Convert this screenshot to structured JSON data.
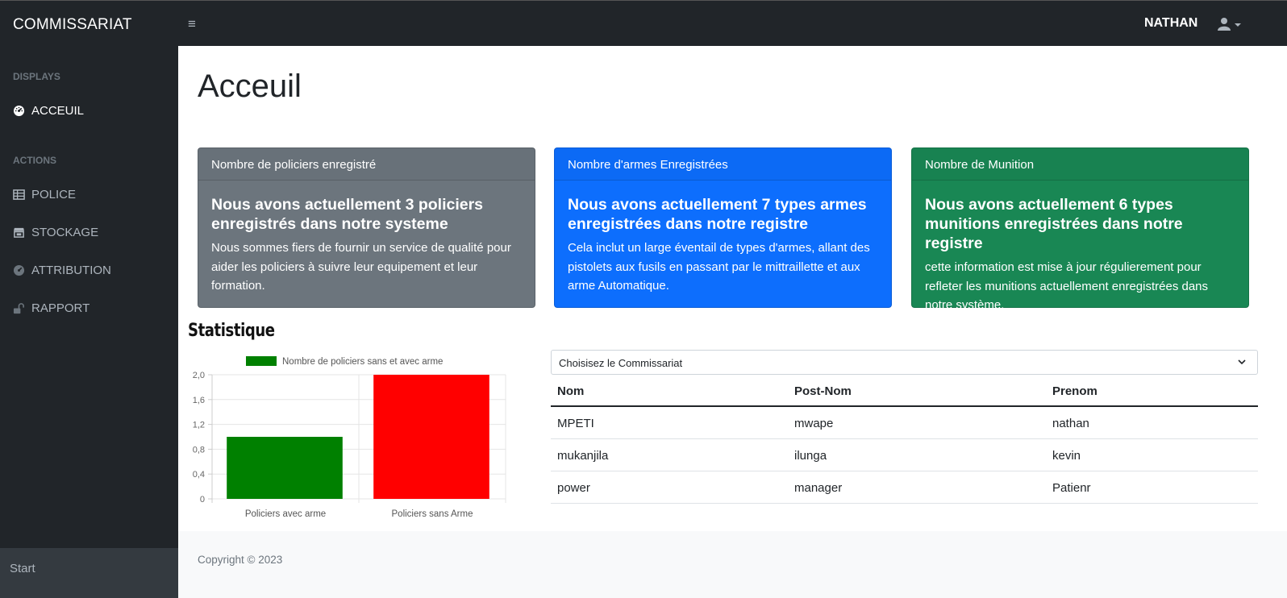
{
  "topbar": {
    "brand": "COMMISSARIAT",
    "toggle_icon": "≡",
    "username": "NATHAN"
  },
  "sidebar": {
    "sections": [
      {
        "label": "DISPLAYS"
      },
      {
        "label": "ACTIONS"
      }
    ],
    "items": [
      {
        "label": "ACCEUIL",
        "icon": "dashboard-icon"
      },
      {
        "label": "POLICE",
        "icon": "table-icon"
      },
      {
        "label": "STOCKAGE",
        "icon": "store-icon"
      },
      {
        "label": "ATTRIBUTION",
        "icon": "dashboard-icon"
      },
      {
        "label": "RAPPORT",
        "icon": "lock-open-icon"
      }
    ],
    "footer": "Start"
  },
  "page": {
    "title": "Acceuil"
  },
  "cards": [
    {
      "header": "Nombre de policiers enregistré",
      "title": "Nous avons actuellement 3 policiers enregistrés dans notre systeme",
      "text": "Nous sommes fiers de fournir un service de qualité pour aider les policiers à suivre leur equipement et leur formation.",
      "color": "#6c757d"
    },
    {
      "header": "Nombre d'armes Enregistrées",
      "title": "Nous avons actuellement 7 types armes enregistrées dans notre registre",
      "text": "Cela inclut un large éventail de types d'armes, allant des pistolets aux fusils en passant par le mittraillette et aux arme Automatique.",
      "color": "#0d6efd"
    },
    {
      "header": "Nombre de Munition",
      "title": "Nous avons actuellement 6 types munitions enregistrées dans notre registre",
      "text": "cette information est mise à jour régulierement pour refleter les munitions actuellement enregistrées dans notre système.",
      "color": "#198754"
    }
  ],
  "statistics": {
    "title": "Statistique"
  },
  "chart_data": {
    "type": "bar",
    "categories": [
      "Policiers avec arme",
      "Policiers sans Arme"
    ],
    "series": [
      {
        "name": "Nombre de policiers sans et avec arme",
        "values": [
          1,
          2
        ],
        "colors": [
          "#008000",
          "#ff0000"
        ]
      }
    ],
    "ylim": [
      0,
      2
    ],
    "yticks": [
      "2,0",
      "1,6",
      "1,2",
      "0,8",
      "0,4",
      "0"
    ],
    "legend": "top",
    "grid": true
  },
  "select": {
    "value": "Choisisez le Commissariat"
  },
  "table": {
    "headers": [
      "Nom",
      "Post-Nom",
      "Prenom"
    ],
    "rows": [
      [
        "MPETI",
        "mwape",
        "nathan"
      ],
      [
        "mukanjila",
        "ilunga",
        "kevin"
      ],
      [
        "power",
        "manager",
        "Patienr"
      ]
    ]
  },
  "footer": {
    "copyright": "Copyright © 2023"
  }
}
